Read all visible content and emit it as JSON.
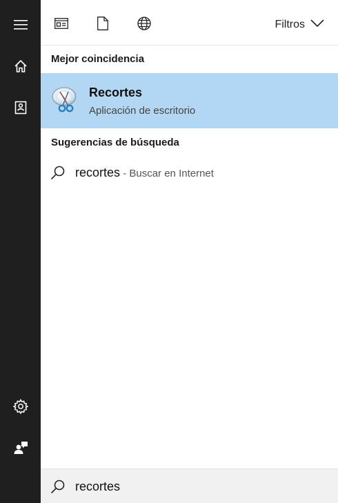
{
  "rail": {
    "items": [
      {
        "icon": "hamburger-menu-icon"
      },
      {
        "icon": "home-icon"
      },
      {
        "icon": "notebook-icon"
      },
      {
        "icon": "settings-gear-icon"
      },
      {
        "icon": "feedback-icon"
      }
    ],
    "background": "#1f1f1f"
  },
  "filter_bar": {
    "filters_label": "Filtros",
    "icons": [
      "apps-icon",
      "documents-icon",
      "web-globe-icon"
    ]
  },
  "best_match": {
    "header": "Mejor coincidencia",
    "title": "Recortes",
    "subtitle": "Aplicación de escritorio",
    "icon": "snipping-tool-icon",
    "highlight_color": "#b3d7f2"
  },
  "suggestions": {
    "header": "Sugerencias de búsqueda",
    "items": [
      {
        "term": "recortes",
        "suffix": " - Buscar en Internet"
      }
    ]
  },
  "search": {
    "value": "recortes"
  }
}
